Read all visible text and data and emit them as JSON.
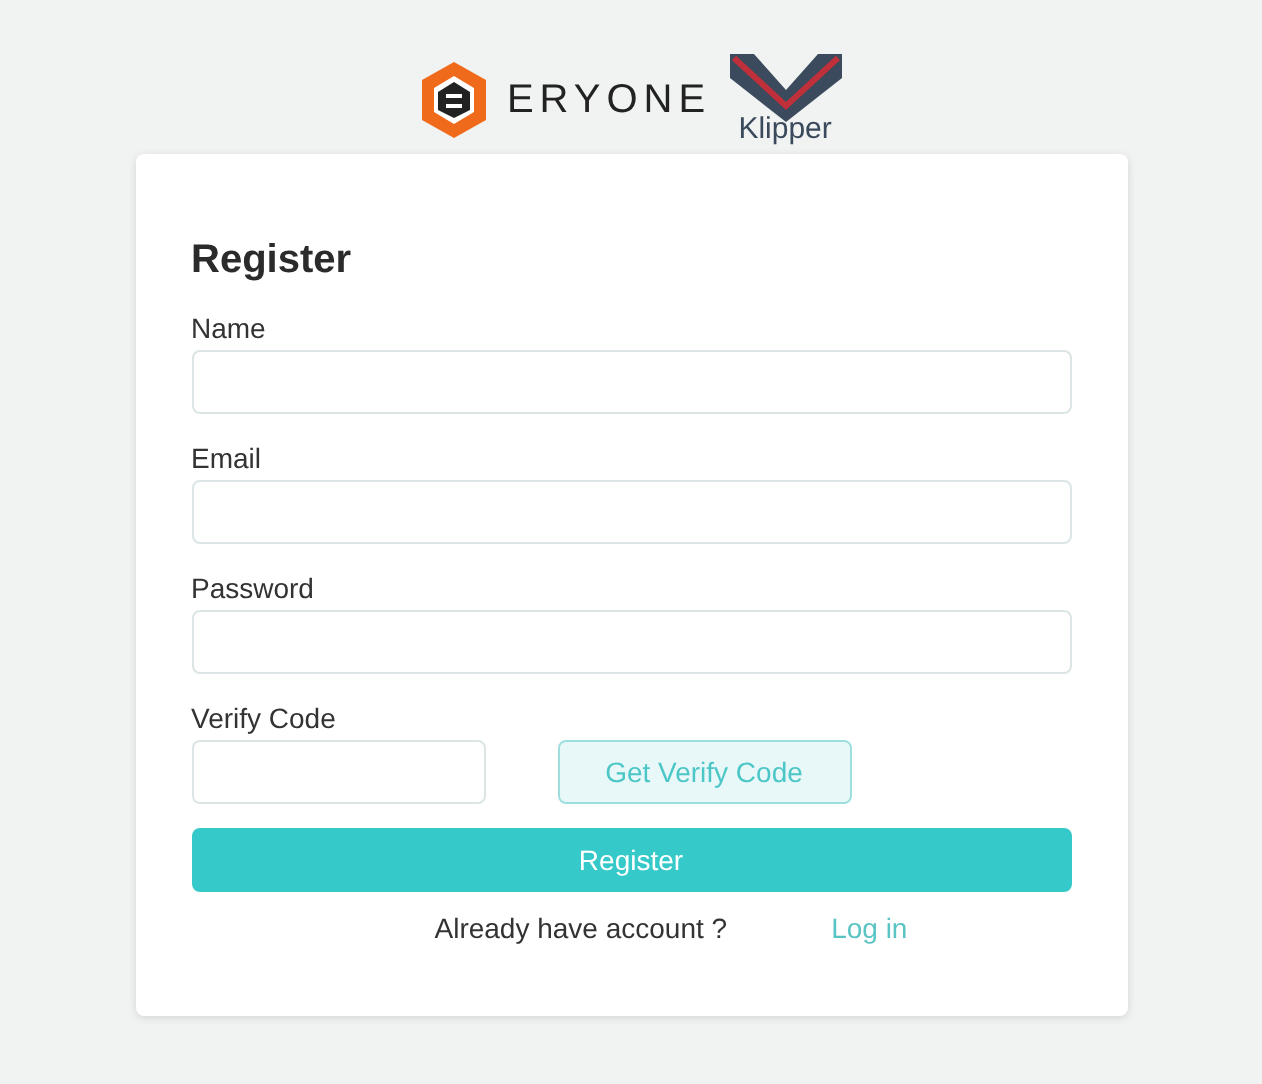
{
  "logo": {
    "brand": "ERYONE",
    "partner": "Klipper"
  },
  "form": {
    "title": "Register",
    "fields": [
      {
        "label": "Name"
      },
      {
        "label": "Email"
      },
      {
        "label": "Password"
      }
    ],
    "verify": {
      "label": "Verify Code",
      "button": "Get Verify Code"
    },
    "submit": "Register",
    "footer": {
      "text": "Already have account ?",
      "link": "Log in"
    }
  }
}
